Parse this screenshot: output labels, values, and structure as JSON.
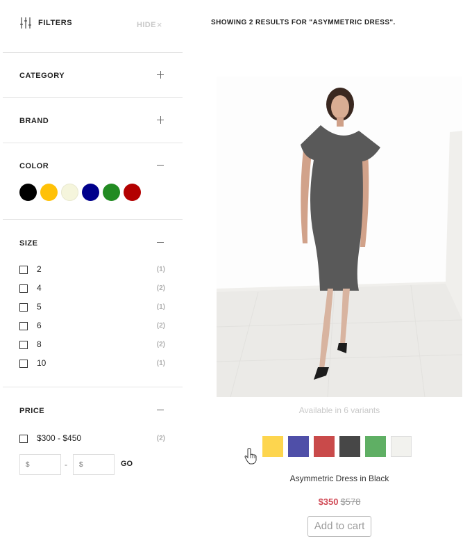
{
  "filters": {
    "title": "FILTERS",
    "hide_label": "HIDE",
    "hide_icon": "×"
  },
  "sections": {
    "category": {
      "title": "CATEGORY",
      "state": "collapsed"
    },
    "brand": {
      "title": "BRAND",
      "state": "collapsed"
    },
    "color": {
      "title": "COLOR",
      "state": "expanded",
      "swatches": [
        "#000000",
        "#FFC107",
        "#F5F5DC",
        "#00008B",
        "#228B22",
        "#B30000"
      ]
    },
    "size": {
      "title": "SIZE",
      "state": "expanded",
      "options": [
        {
          "label": "2",
          "count": "(1)"
        },
        {
          "label": "4",
          "count": "(2)"
        },
        {
          "label": "5",
          "count": "(1)"
        },
        {
          "label": "6",
          "count": "(2)"
        },
        {
          "label": "8",
          "count": "(2)"
        },
        {
          "label": "10",
          "count": "(1)"
        }
      ]
    },
    "price": {
      "title": "PRICE",
      "state": "expanded",
      "range_label": "$300 - $450",
      "range_count": "(2)",
      "min_placeholder": "$",
      "max_placeholder": "$",
      "separator": "-",
      "go_label": "GO"
    }
  },
  "results": {
    "text": "SHOWING 2 RESULTS FOR \"ASYMMETRIC DRESS\"."
  },
  "product": {
    "variants_text": "Available in 6 variants",
    "variant_colors": [
      "#FDD54E",
      "#4F4FA8",
      "#C94A4A",
      "#474747",
      "#5FAF64",
      "#F2F2EE"
    ],
    "name": "Asymmetric Dress in Black",
    "sale_price": "$350",
    "original_price": "$578",
    "add_to_cart_label": "Add to cart"
  },
  "colors": {
    "accent_sale": "#D14B57",
    "muted": "#C9C9C9"
  }
}
